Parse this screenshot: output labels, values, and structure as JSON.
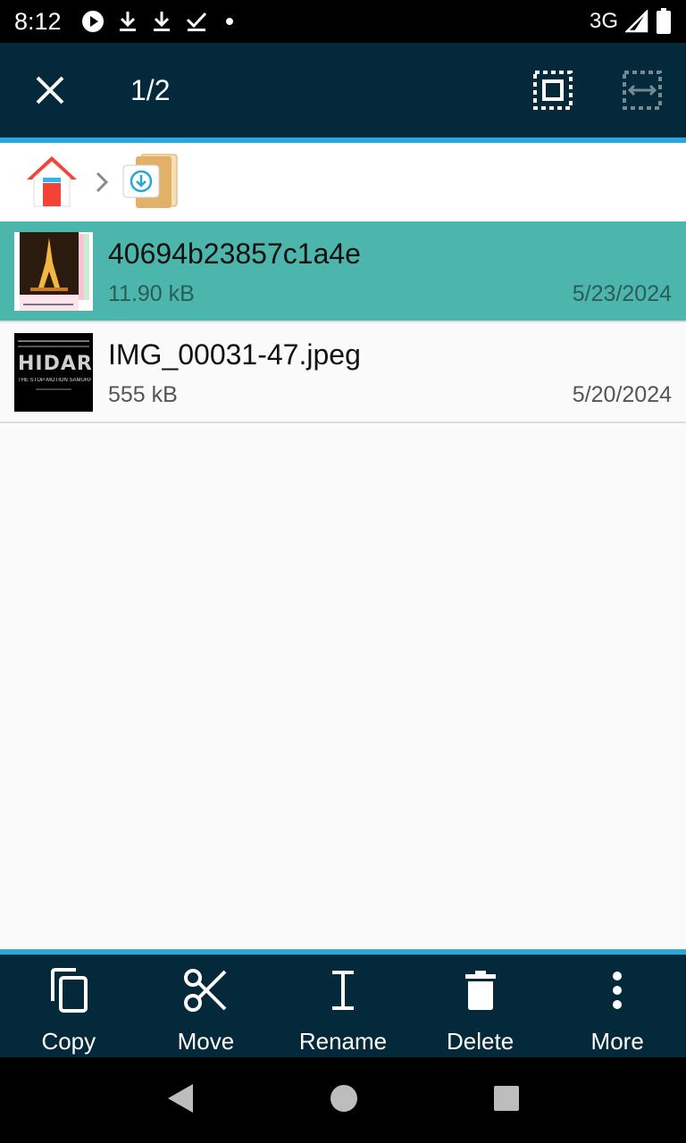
{
  "status": {
    "time": "8:12",
    "network": "3G",
    "icons": [
      "play-circle-icon",
      "download-icon",
      "download-icon",
      "download-done-icon",
      "dot-icon"
    ]
  },
  "appbar": {
    "selection_count": "1/2",
    "close_icon": "close-icon",
    "select_all_icon": "select-all-icon",
    "select_range_icon": "select-range-icon"
  },
  "breadcrumb": {
    "home_icon": "home-icon",
    "folder_icon": "download-folder-icon"
  },
  "files": [
    {
      "name": "40694b23857c1a4e",
      "size": "11.90 kB",
      "date": "5/23/2024",
      "selected": true
    },
    {
      "name": "IMG_00031-47.jpeg",
      "size": "555 kB",
      "date": "5/20/2024",
      "selected": false
    }
  ],
  "thumb2": {
    "title": "HIDARI",
    "subtitle": "THE STOP-MOTION SAMURAI FILM"
  },
  "actions": [
    {
      "label": "Copy",
      "icon": "copy-icon"
    },
    {
      "label": "Move",
      "icon": "scissors-icon"
    },
    {
      "label": "Rename",
      "icon": "text-cursor-icon"
    },
    {
      "label": "Delete",
      "icon": "trash-icon"
    },
    {
      "label": "More",
      "icon": "more-vert-icon"
    }
  ],
  "colors": {
    "appbar": "#04293a",
    "accent": "#2aa8d9",
    "selected_row": "#4db6ac"
  }
}
